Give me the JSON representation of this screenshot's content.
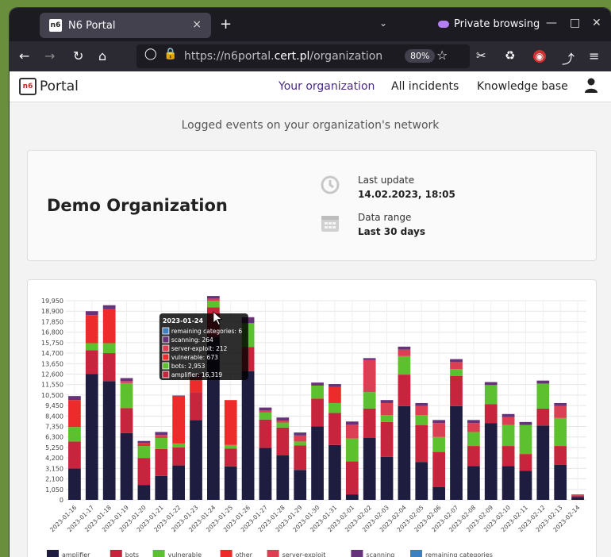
{
  "browser": {
    "tab_title": "N6 Portal",
    "tab_close": "×",
    "new_tab": "+",
    "private_label": "Private browsing",
    "url_prefix": "https://n6portal.",
    "url_host": "cert.pl",
    "url_path": "/organization",
    "zoom": "80%"
  },
  "header": {
    "logo_text": "Portal",
    "nav": [
      "Your organization",
      "All incidents",
      "Knowledge base"
    ]
  },
  "page": {
    "subtitle": "Logged events on your organization's network"
  },
  "org_card": {
    "name": "Demo Organization",
    "last_update_label": "Last update",
    "last_update_value": "14.02.2023, 18:05",
    "data_range_label": "Data range",
    "data_range_value": "Last 30 days"
  },
  "chart_data": {
    "type": "bar",
    "stacked": true,
    "categories": [
      "2023-01-16",
      "2023-01-17",
      "2023-01-18",
      "2023-01-19",
      "2023-01-20",
      "2023-01-21",
      "2023-01-22",
      "2023-01-23",
      "2023-01-24",
      "2023-01-25",
      "2023-01-26",
      "2023-01-27",
      "2023-01-28",
      "2023-01-29",
      "2023-01-30",
      "2023-01-31",
      "2023-02-01",
      "2023-02-02",
      "2023-02-03",
      "2023-02-04",
      "2023-02-05",
      "2023-02-06",
      "2023-02-07",
      "2023-02-08",
      "2023-02-09",
      "2023-02-10",
      "2023-02-11",
      "2023-02-12",
      "2023-02-13",
      "2023-02-14"
    ],
    "y_ticks": [
      "19,950",
      "18,900",
      "17,850",
      "16,800",
      "15,750",
      "14,700",
      "13,650",
      "12,600",
      "11,550",
      "10,500",
      "9,450",
      "8,400",
      "7,350",
      "6,300",
      "5,250",
      "4,200",
      "3,150",
      "2,100",
      "1,050",
      "0"
    ],
    "ylim": [
      0,
      19950
    ],
    "series": [
      {
        "name": "amplifier",
        "color": "#1e1d3f",
        "values": [
          3150,
          12600,
          11900,
          6700,
          1500,
          2400,
          3450,
          8000,
          16319,
          3350,
          12900,
          5200,
          4450,
          3000,
          7350,
          5500,
          550,
          6200,
          4300,
          9400,
          3800,
          1300,
          9400,
          3400,
          7700,
          3400,
          2900,
          7450,
          3500,
          300
        ]
      },
      {
        "name": "bots",
        "color": "#c7253e",
        "values": [
          2700,
          2400,
          2800,
          2500,
          2700,
          2700,
          1800,
          2800,
          2953,
          1800,
          2400,
          2850,
          2800,
          2450,
          2800,
          3200,
          3300,
          2950,
          3500,
          3150,
          3700,
          3500,
          3000,
          2000,
          1900,
          2000,
          1700,
          1700,
          1900,
          150
        ]
      },
      {
        "name": "vulnerable",
        "color": "#5cc02f",
        "values": [
          1450,
          700,
          1000,
          2500,
          1200,
          1100,
          400,
          0,
          673,
          350,
          2400,
          700,
          500,
          400,
          1300,
          1000,
          2300,
          1650,
          700,
          1850,
          1000,
          1500,
          700,
          1400,
          1900,
          2100,
          2900,
          2500,
          2800,
          0
        ]
      },
      {
        "name": "other",
        "color": "#ee2b2b",
        "values": [
          2700,
          2800,
          3400,
          0,
          300,
          0,
          4700,
          1500,
          0,
          4500,
          0,
          0,
          0,
          0,
          0,
          1600,
          0,
          0,
          0,
          0,
          0,
          0,
          0,
          0,
          0,
          0,
          0,
          0,
          0,
          0
        ]
      },
      {
        "name": "server-exploit",
        "color": "#dc3f53",
        "values": [
          0,
          0,
          0,
          200,
          0,
          300,
          0,
          0,
          212,
          0,
          0,
          200,
          200,
          600,
          0,
          0,
          1400,
          3200,
          1200,
          650,
          900,
          1400,
          700,
          900,
          0,
          800,
          0,
          0,
          1200,
          100
        ]
      },
      {
        "name": "scanning",
        "color": "#66337a",
        "values": [
          400,
          400,
          400,
          300,
          200,
          300,
          100,
          300,
          264,
          0,
          600,
          300,
          300,
          300,
          300,
          300,
          300,
          200,
          300,
          300,
          300,
          300,
          300,
          300,
          300,
          300,
          300,
          300,
          300,
          0
        ]
      },
      {
        "name": "remaining categories",
        "color": "#3c7fc2",
        "values": [
          0,
          0,
          0,
          0,
          0,
          0,
          0,
          0,
          6,
          0,
          0,
          0,
          0,
          0,
          0,
          0,
          0,
          0,
          0,
          0,
          0,
          0,
          0,
          0,
          0,
          0,
          0,
          0,
          0,
          0
        ]
      }
    ],
    "tooltip": {
      "title": "2023-01-24",
      "lines": [
        "remaining categories: 6",
        "scanning: 264",
        "server-exploit: 212",
        "vulnerable: 673",
        "bots: 2,953",
        "amplifier: 16,319"
      ]
    }
  }
}
